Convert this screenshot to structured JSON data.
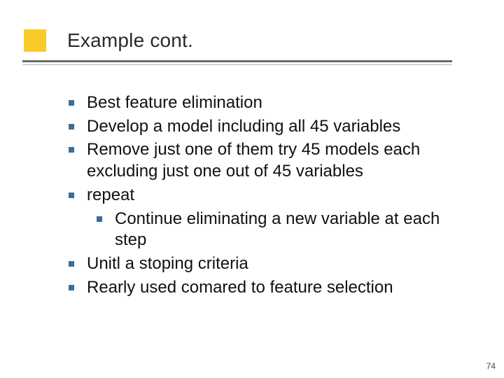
{
  "title": "Example cont.",
  "bullets": {
    "b0": "Best feature elimination",
    "b1": "Develop a model including all 45 variables",
    "b2": "Remove just one of them try 45 models each excluding just one out of 45 variables",
    "b3": "repeat",
    "b3a": "Continue eliminating a new variable at each step",
    "b4": "Unitl a stoping criteria",
    "b5": "Rearly used comared to feature selection"
  },
  "page_number": "74"
}
